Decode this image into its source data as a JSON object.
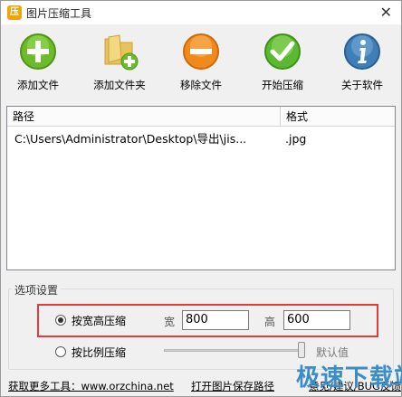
{
  "window": {
    "title": "图片压缩工具",
    "app_icon": "压",
    "close_glyph": "✕"
  },
  "toolbar": {
    "buttons": [
      {
        "label": "添加文件",
        "icon": "add-file-icon"
      },
      {
        "label": "添加文件夹",
        "icon": "add-folder-icon"
      },
      {
        "label": "移除文件",
        "icon": "remove-file-icon"
      },
      {
        "label": "开始压缩",
        "icon": "start-compress-icon"
      },
      {
        "label": "关于软件",
        "icon": "about-icon"
      }
    ]
  },
  "file_list": {
    "columns": [
      "路径",
      "格式"
    ],
    "rows": [
      {
        "path": "C:\\Users\\Administrator\\Desktop\\导出\\jis...",
        "format": ".jpg"
      }
    ]
  },
  "options": {
    "group_title": "选项设置",
    "by_size": {
      "label": "按宽高压缩",
      "selected": true,
      "width_label": "宽",
      "width_value": "800",
      "height_label": "高",
      "height_value": "600"
    },
    "by_ratio": {
      "label": "按比例压缩",
      "selected": false,
      "slider_value_label": "默认值"
    }
  },
  "footer": {
    "more_tools": "获取更多工具：www.orzchina.net",
    "open_save_path": "打开图片保存路径",
    "feedback": "意见/建议/BUG反馈"
  },
  "watermark": "极速下载站",
  "colors": {
    "highlight_box": "#e33b3b",
    "watermark": "#3a8dc6"
  }
}
